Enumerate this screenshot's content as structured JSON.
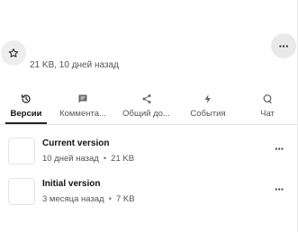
{
  "header": {
    "more_icon": "more-horizontal-icon",
    "favorite_icon": "star-outline-icon",
    "file_meta": "21 KB, 10 дней назад"
  },
  "tabs": [
    {
      "label": "Версии",
      "icon": "history-icon",
      "active": true
    },
    {
      "label": "Коммента...",
      "icon": "comment-icon",
      "active": false
    },
    {
      "label": "Общий до...",
      "icon": "share-icon",
      "active": false
    },
    {
      "label": "События",
      "icon": "activity-bolt-icon",
      "active": false
    },
    {
      "label": "Чат",
      "icon": "chat-icon",
      "active": false
    }
  ],
  "versions": [
    {
      "title": "Current version",
      "age": "10 дней назад",
      "size": "21 KB"
    },
    {
      "title": "Initial version",
      "age": "3 месяца назад",
      "size": "7 KB"
    }
  ],
  "separator": "•",
  "more_glyph": "···"
}
